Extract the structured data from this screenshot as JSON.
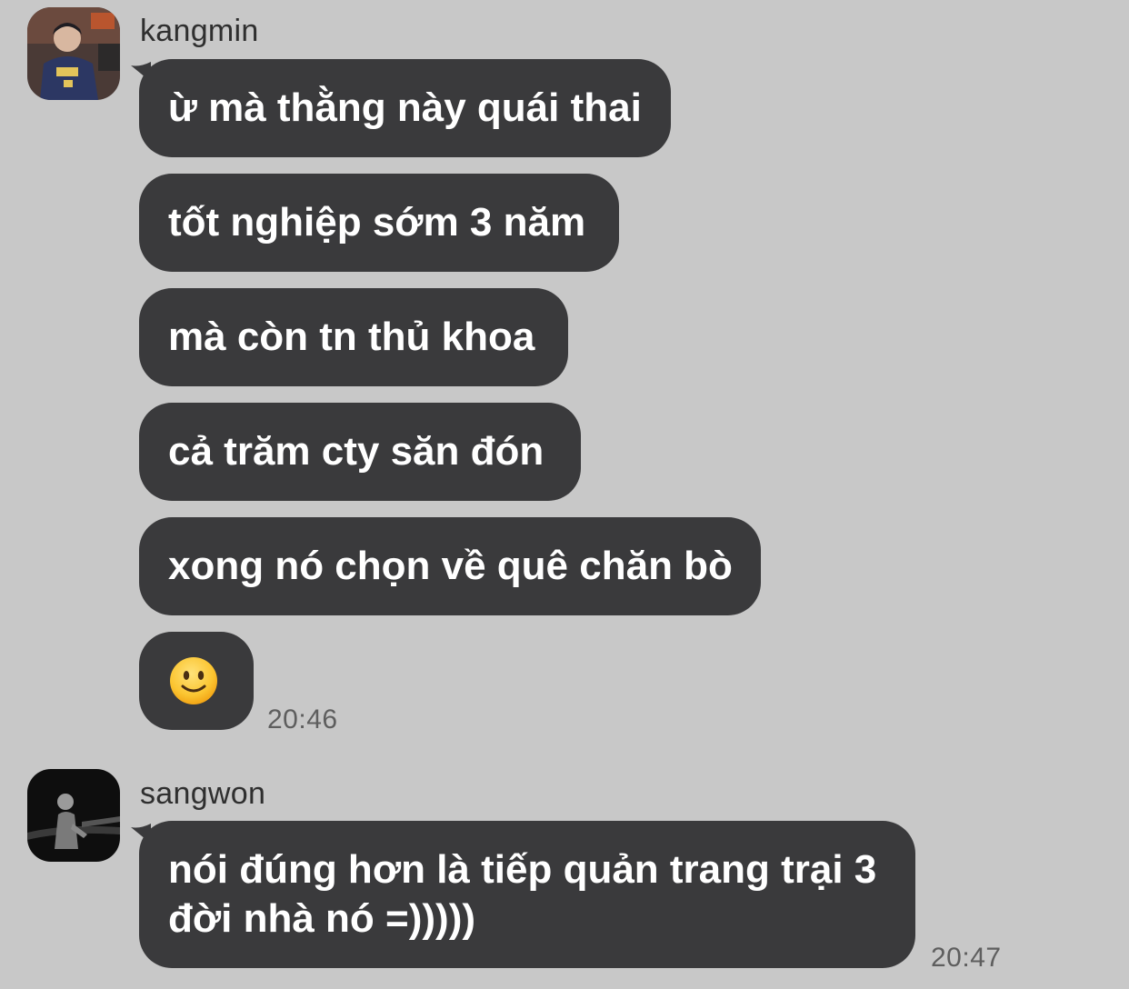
{
  "messages": [
    {
      "sender": "kangmin",
      "avatar_icon": "user-avatar-hoodie-icon",
      "bubbles": [
        "ừ mà thằng này quái thai",
        "tốt nghiệp sớm 3 năm",
        "mà còn tn thủ khoa",
        "cả trăm cty săn đón",
        "xong nó chọn về quê chăn bò"
      ],
      "emoji": "slightly-smiling-face-emoji",
      "time": "20:46"
    },
    {
      "sender": "sangwon",
      "avatar_icon": "user-avatar-dark-photo-icon",
      "bubbles": [
        "nói đúng hơn là tiếp quản trang trại 3 đời nhà nó =)))))"
      ],
      "time": "20:47"
    }
  ],
  "colors": {
    "background": "#c8c8c8",
    "bubble": "#3a3a3c",
    "bubble_text": "#ffffff",
    "meta_text": "#5e5e5e"
  }
}
